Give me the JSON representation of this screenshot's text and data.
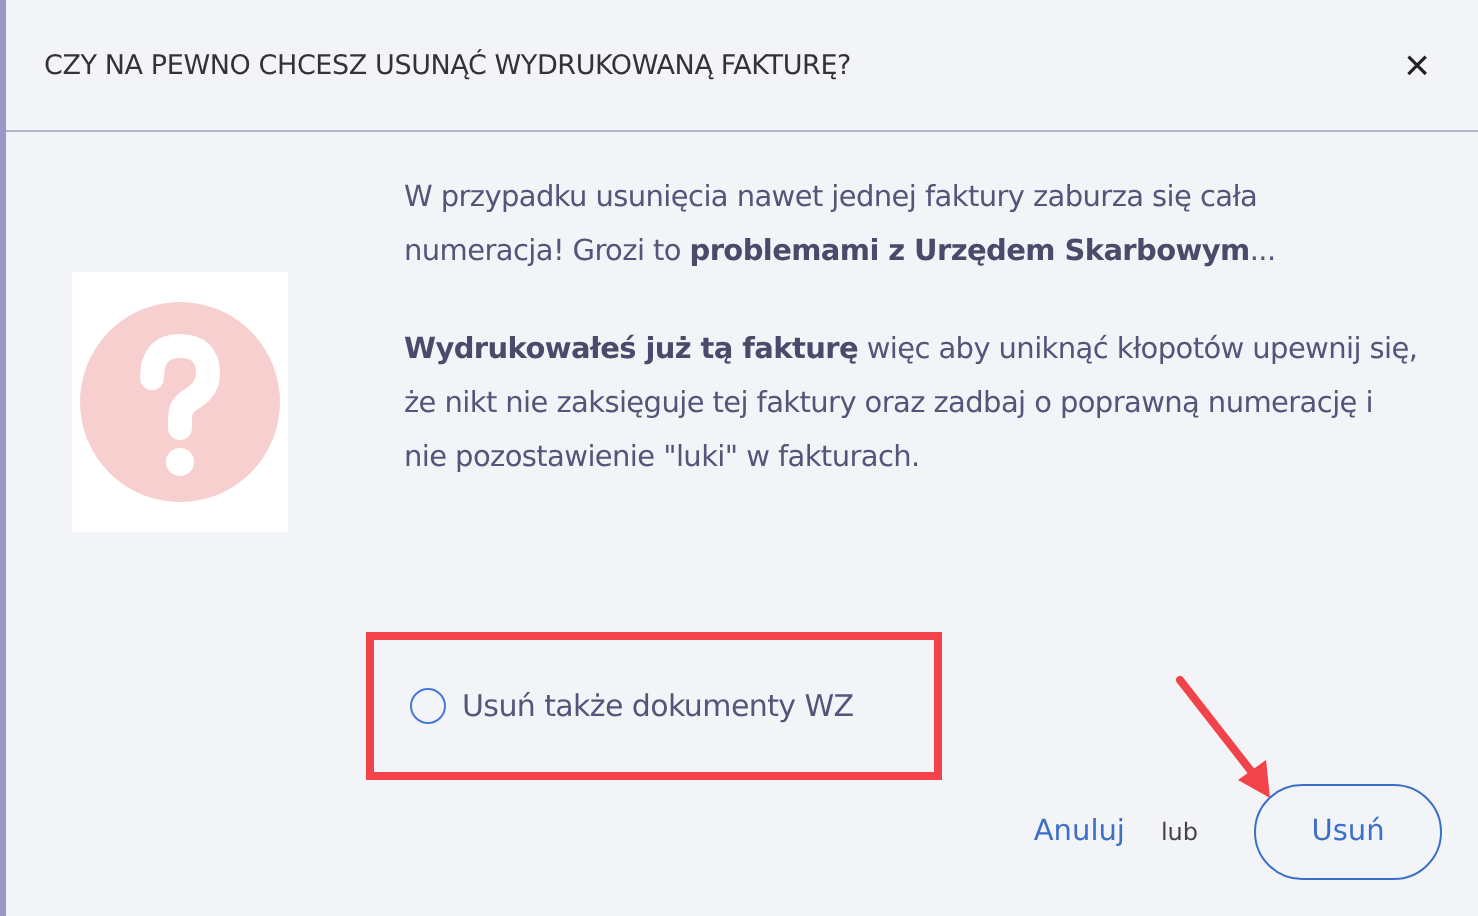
{
  "dialog": {
    "title": "CZY NA PEWNO CHCESZ USUNĄĆ WYDRUKOWANĄ FAKTURĘ?",
    "close": "×"
  },
  "message": [
    "W przypadku usunięcia nawet jednej faktury zaburza się cała numeracja! Grozi to **problemami z Urzędem Skarbowym**...",
    "**Wydrukowałeś już tą fakturę** więc aby uniknąć kłopotów upewnij się, że nikt nie zaksięguje tej faktury oraz zadbaj o poprawną numerację i nie pozostawienie \"luki\" w fakturach."
  ],
  "option": {
    "label": "Usuń także dokumenty WZ",
    "selected": false
  },
  "footer": {
    "cancel": "Anuluj",
    "separator": "lub",
    "confirm": "Usuń"
  }
}
